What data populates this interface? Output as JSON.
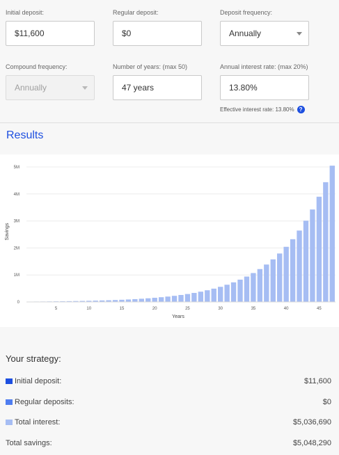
{
  "form": {
    "initial_deposit": {
      "label": "Initial deposit:",
      "value": "$11,600"
    },
    "regular_deposit": {
      "label": "Regular deposit:",
      "value": "$0"
    },
    "deposit_frequency": {
      "label": "Deposit frequency:",
      "value": "Annually"
    },
    "compound_frequency": {
      "label": "Compound frequency:",
      "value": "Annually"
    },
    "years": {
      "label": "Number of years: (max 50)",
      "value": "47 years"
    },
    "interest_rate": {
      "label": "Annual interest rate: (max 20%)",
      "value": "13.80%"
    },
    "effective_rate": {
      "text": "Effective interest rate: 13.80%",
      "help_icon": "?"
    }
  },
  "results": {
    "title": "Results"
  },
  "chart_data": {
    "type": "bar",
    "xlabel": "Years",
    "ylabel": "Savings",
    "ylim": [
      0,
      5000000
    ],
    "yticks": [
      {
        "v": 0,
        "label": "0"
      },
      {
        "v": 1000000,
        "label": "1M"
      },
      {
        "v": 2000000,
        "label": "2M"
      },
      {
        "v": 3000000,
        "label": "3M"
      },
      {
        "v": 4000000,
        "label": "4M"
      },
      {
        "v": 5000000,
        "label": "5M"
      }
    ],
    "xticks": [
      5,
      10,
      15,
      20,
      25,
      30,
      35,
      40,
      45
    ],
    "grid": true,
    "bar_color": "#a6bdf3",
    "series": [
      {
        "x": [
          1,
          2,
          3,
          4,
          5,
          6,
          7,
          8,
          9,
          10,
          11,
          12,
          13,
          14,
          15,
          16,
          17,
          18,
          19,
          20,
          21,
          22,
          23,
          24,
          25,
          26,
          27,
          28,
          29,
          30,
          31,
          32,
          33,
          34,
          35,
          36,
          37,
          38,
          39,
          40,
          41,
          42,
          43,
          44,
          45,
          46,
          47
        ],
        "values": [
          13201,
          15023,
          17096,
          19455,
          22140,
          25195,
          28672,
          32629,
          37131,
          42255,
          48086,
          54722,
          62274,
          70868,
          80648,
          91777,
          104442,
          118855,
          135257,
          153923,
          175164,
          199337,
          226846,
          258151,
          293776,
          334317,
          380453,
          432955,
          492703,
          560696,
          638072,
          726126,
          826331,
          940365,
          1070136,
          1217815,
          1385874,
          1577124,
          1794767,
          2042445,
          2324302,
          2645056,
          3010074,
          3425464,
          3898178,
          4436127,
          5048290
        ]
      }
    ]
  },
  "strategy": {
    "title": "Your strategy:",
    "rows": [
      {
        "label": "Initial deposit:",
        "value": "$11,600",
        "color": "#1d4fe0"
      },
      {
        "label": "Regular deposits:",
        "value": "$0",
        "color": "#4f7df0"
      },
      {
        "label": "Total interest:",
        "value": "$5,036,690",
        "color": "#a6bdf3"
      },
      {
        "label": "Total savings:",
        "value": "$5,048,290"
      }
    ]
  }
}
